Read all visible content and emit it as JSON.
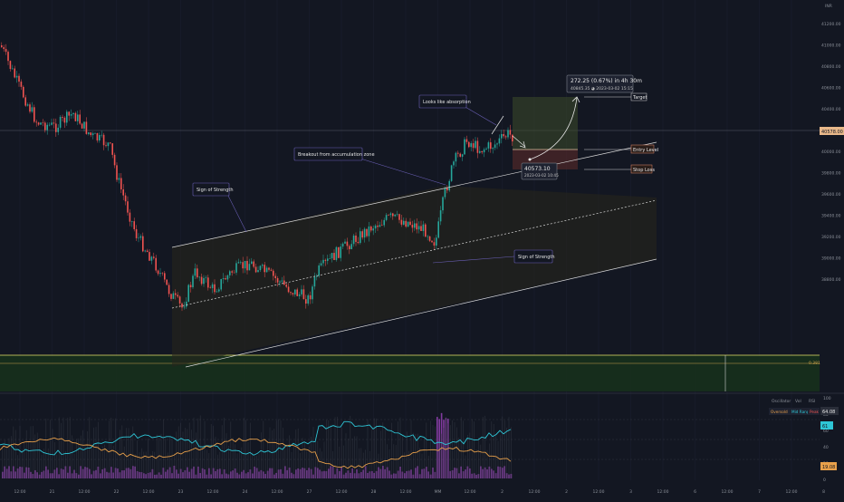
{
  "header": {
    "currency": "INR"
  },
  "colors": {
    "background": "#131722",
    "up": "#26a69a",
    "down": "#ef5350",
    "channel": "#d9d9d9",
    "target_zone": "#3a4a2a",
    "stop_zone": "#5a2a2a",
    "support_zone": "#1f3a1f",
    "support_line": "#e8e36a",
    "cyan_line": "#2ec6d6",
    "orange_line": "#e8a04a",
    "volume_bar": "#b24bd6"
  },
  "price_axis": {
    "ticks": [
      "41200.00",
      "41000.00",
      "40800.00",
      "40600.00",
      "40400.00",
      "40200.00",
      "40000.00",
      "39800.00",
      "39600.00",
      "39400.00",
      "39200.00",
      "39000.00",
      "38800.00"
    ],
    "current_price": "40578.00",
    "support_price": "0.381"
  },
  "time_axis": {
    "ticks": [
      "12:00",
      "21",
      "12:00",
      "22",
      "12:00",
      "23",
      "12:00",
      "24",
      "12:00",
      "27",
      "12:00",
      "28",
      "12:00",
      "MM",
      "12:00",
      "2",
      "12:00",
      "2",
      "12:00",
      "3",
      "12:00",
      "6",
      "12:00",
      "7",
      "12:00",
      "8",
      "12:00",
      "9"
    ]
  },
  "annotations": {
    "sign_of_strength_1": "Sign of Strength",
    "sign_of_strength_2": "Sign of Strength",
    "breakout": "Breakout from accumulation zone",
    "absorption": "Looks like absorption",
    "target": "Target",
    "entry": "Entry Level",
    "stop": "Stop Loss",
    "measure_main": "272.25 (0.67%) in 4h 30m",
    "measure_sub": "40845.35 ◕ 2023-03-02  15:15",
    "entry_price": "40573.10",
    "entry_time": "2023-03-02 10:45"
  },
  "indicator": {
    "legend_buttons": [
      "Oversold",
      "Mid Range",
      "Peak"
    ],
    "top_buttons": [
      "Oscillator",
      "Vol",
      "RSI"
    ],
    "value_cyan": "61",
    "value_orange": "19.08",
    "value_top": "64.08",
    "axis_ticks": [
      "100",
      "80",
      "60",
      "40",
      "20",
      "0"
    ]
  },
  "chart_data": {
    "type": "candlestick",
    "price_range": [
      38700,
      41300
    ],
    "support_level": 38860,
    "entry_level": 40573.1,
    "target_level": 40845.35,
    "stop_loss": 40440
  }
}
